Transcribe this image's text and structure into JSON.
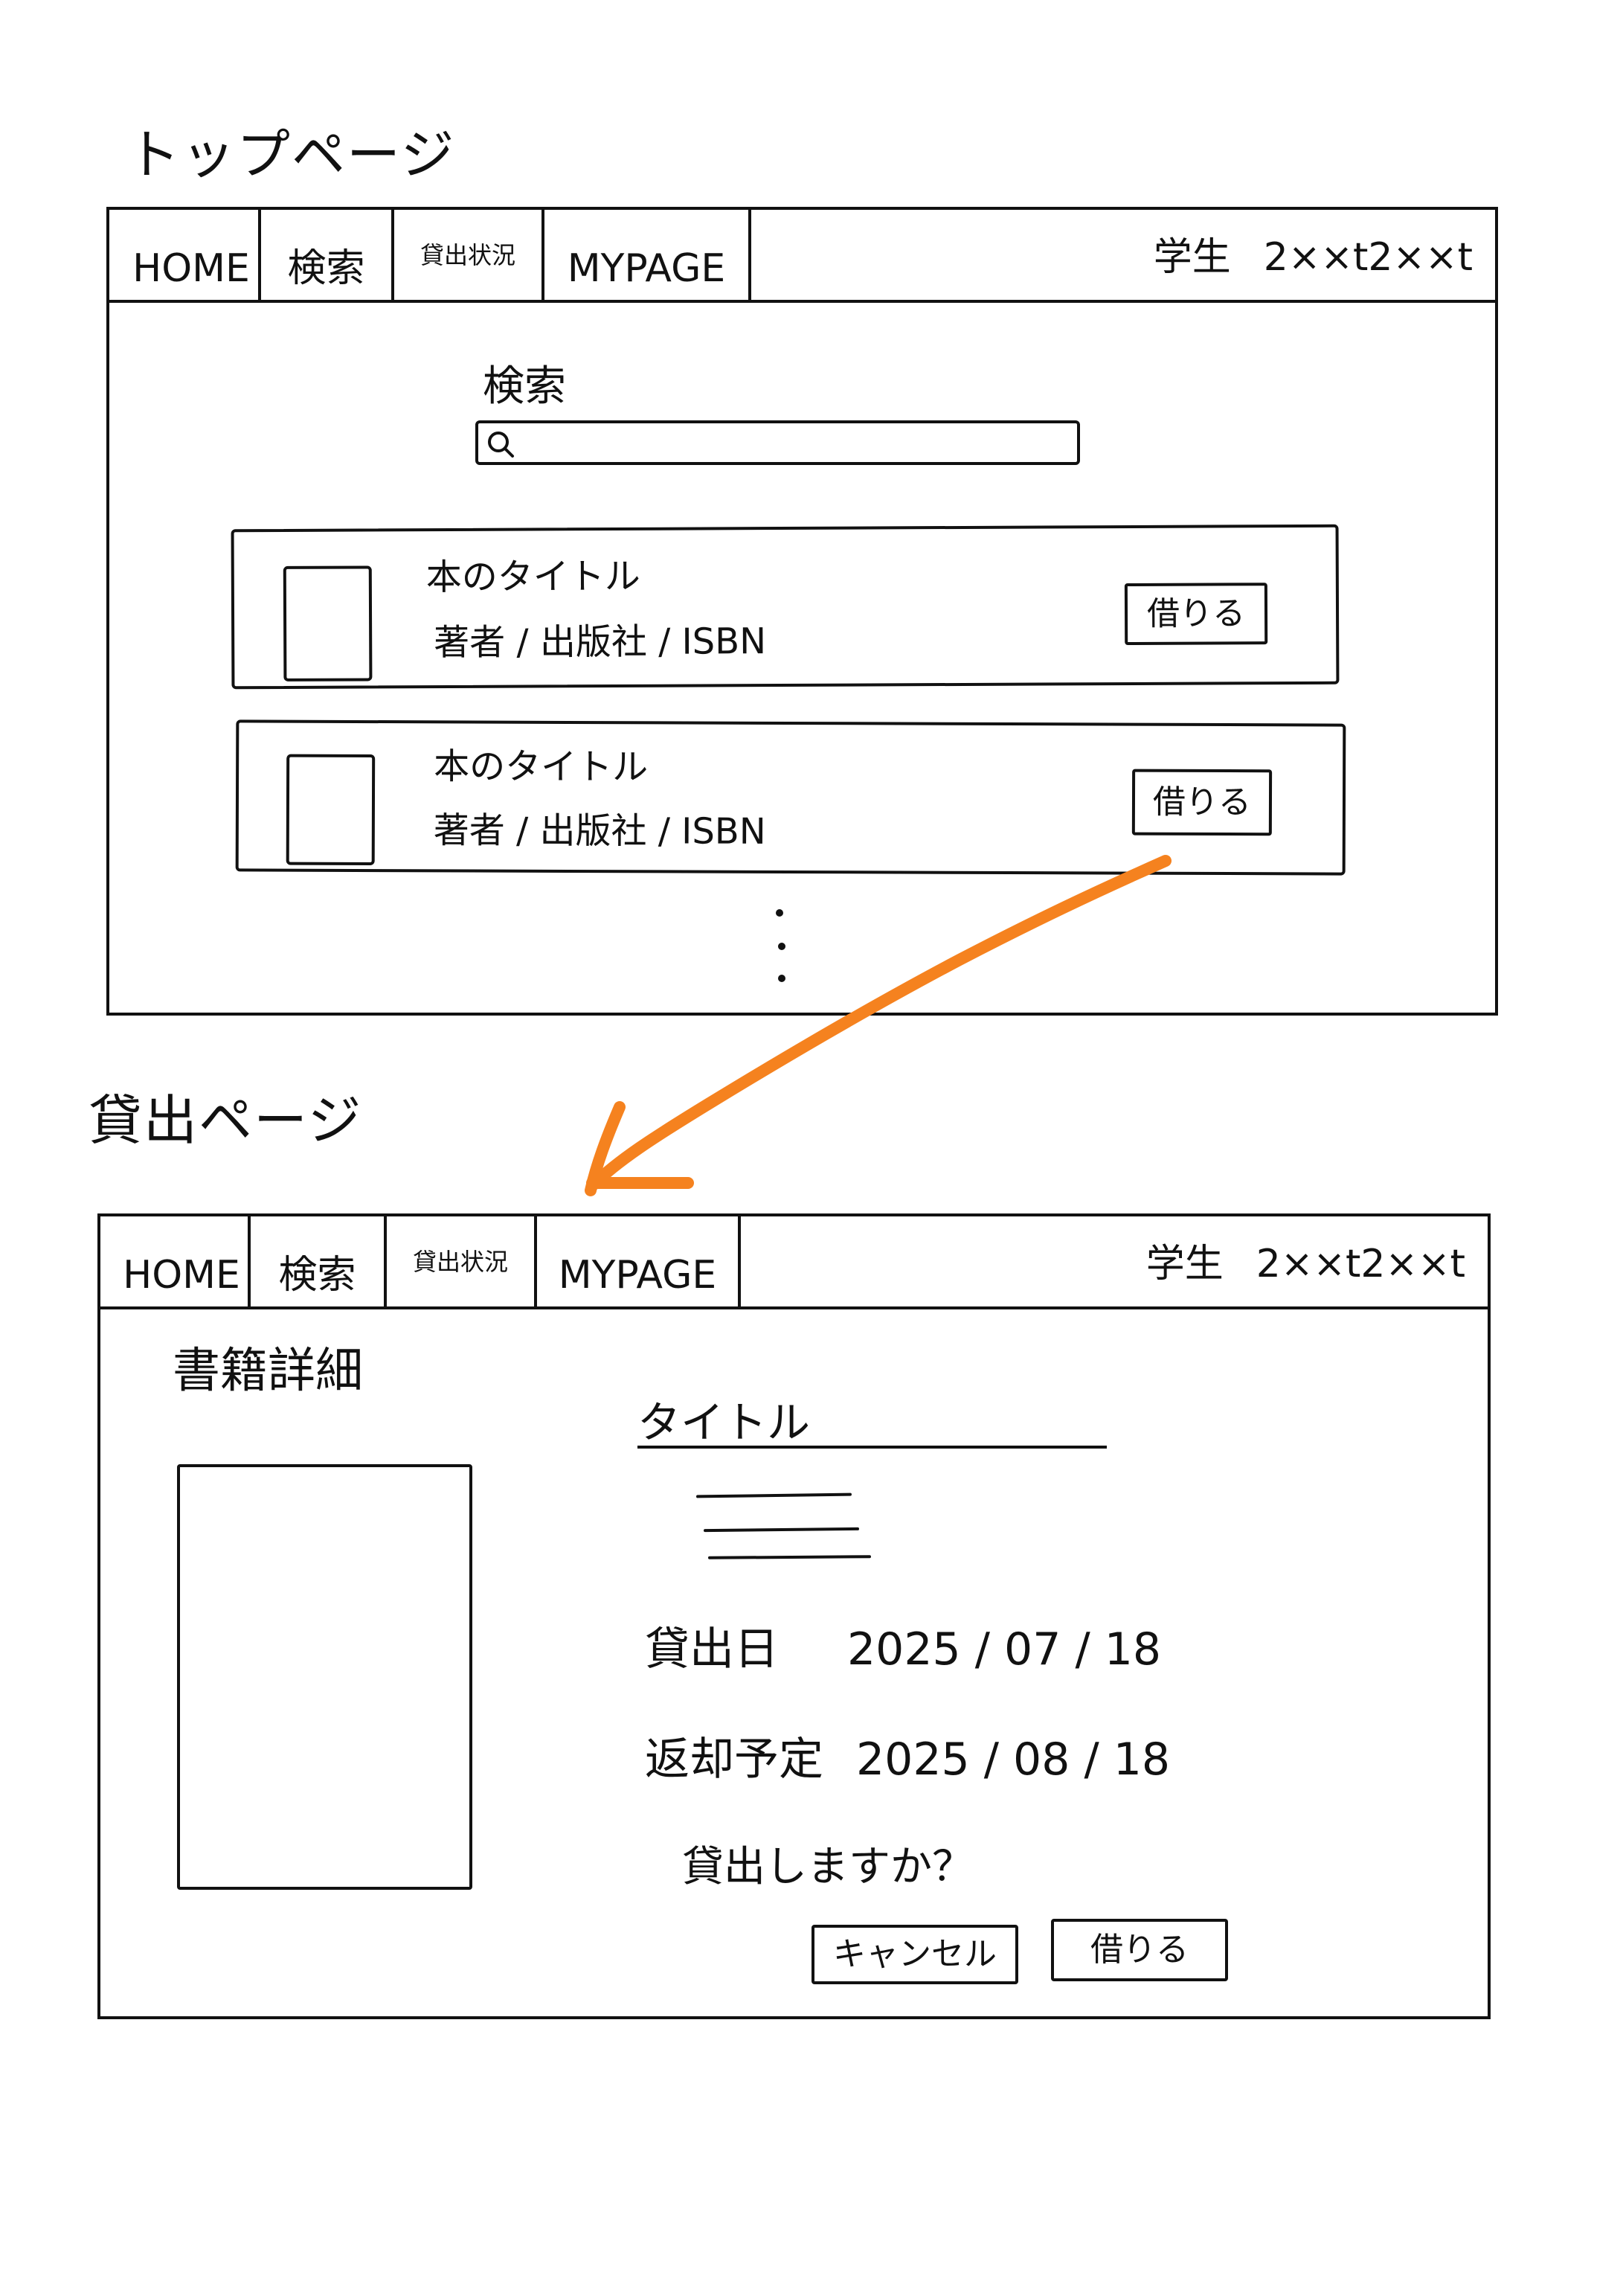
{
  "pages": {
    "top": {
      "title": "トップページ",
      "nav": {
        "home": "HOME",
        "search": "検索",
        "loans": "貸出状況",
        "mypage": "MYPAGE"
      },
      "user": {
        "role": "学生",
        "id": "2××t2××t"
      },
      "search": {
        "label": "検索",
        "icon": "search-icon"
      },
      "books": [
        {
          "title": "本のタイトル",
          "meta": "著者 / 出版社 / ISBN",
          "borrow_label": "借りる"
        },
        {
          "title": "本のタイトル",
          "meta": "著者 / 出版社 / ISBN",
          "borrow_label": "借りる"
        }
      ]
    },
    "loan": {
      "title": "貸出ページ",
      "nav": {
        "home": "HOME",
        "search": "検索",
        "loans": "貸出状況",
        "mypage": "MYPAGE"
      },
      "user": {
        "role": "学生",
        "id": "2××t2××t"
      },
      "heading": "書籍詳細",
      "book_title": "タイトル",
      "loan_date": {
        "label": "貸出日",
        "value": "2025 / 07 / 18"
      },
      "due_date": {
        "label": "返却予定",
        "value": "2025 / 08 / 18"
      },
      "confirm": "貸出しますか？",
      "cancel_label": "キャンセル",
      "borrow_label": "借りる"
    }
  },
  "colors": {
    "ink": "#111111",
    "arrow": "#F5821F",
    "paper": "#FFFFFF"
  }
}
